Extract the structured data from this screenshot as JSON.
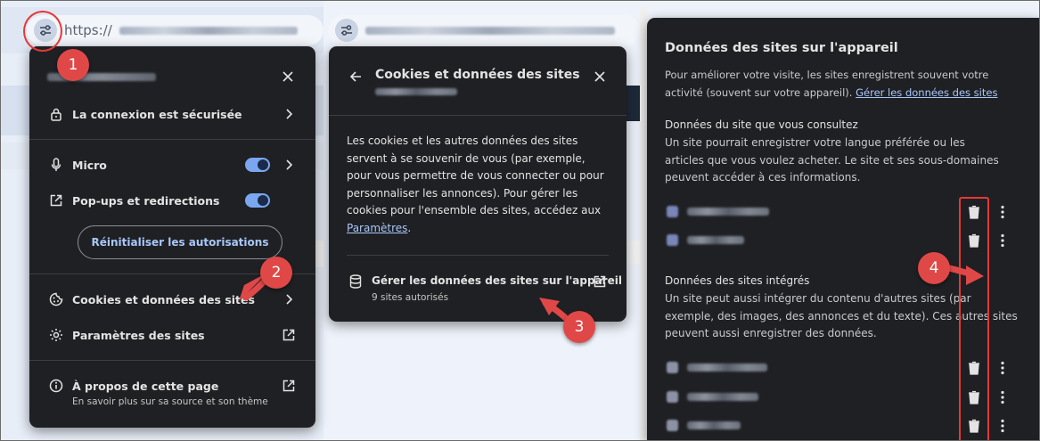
{
  "browser": {
    "url_prefix": "https://"
  },
  "site_panel": {
    "items": {
      "secure": "La connexion est sécurisée",
      "micro": "Micro",
      "popups": "Pop-ups et redirections",
      "reset": "Réinitialiser les autorisations",
      "cookies": "Cookies et données des sites",
      "settings": "Paramètres des sites",
      "about": "À propos de cette page",
      "about_sub": "En savoir plus sur sa source et son thème"
    },
    "toggles": {
      "micro": true,
      "popups": true
    }
  },
  "cookies_panel": {
    "title": "Cookies et données des sites",
    "body": "Les cookies et les autres données des sites servent à se souvenir de vous (par exemple, pour vous permettre de vous connecter ou pour personnaliser les annonces). Pour gérer les cookies pour l'ensemble des sites, accédez aux ",
    "body_link": "Paramètres",
    "body_end": ".",
    "manage": "Gérer les données des sites sur l'appareil",
    "manage_sub": "9 sites autorisés"
  },
  "device_panel": {
    "title": "Données des sites sur l'appareil",
    "intro": "Pour améliorer votre visite, les sites enregistrent souvent votre activité (souvent sur votre appareil). ",
    "intro_link": "Gérer les données des sites",
    "section1_title": "Données du site que vous consultez",
    "section1_body": "Un site pourrait enregistrer votre langue préférée ou les articles que vous voulez acheter. Le site et ses sous-domaines peuvent accéder à ces informations.",
    "section2_title": "Données des sites intégrés",
    "section2_body": "Un site peut aussi intégrer du contenu d'autres sites (par exemple, des images, des annonces et du texte). Ces autres sites peuvent aussi enregistrer des données."
  },
  "badges": [
    "1",
    "2",
    "3",
    "4"
  ],
  "colors": {
    "panel_bg": "#1f2023",
    "accent": "#a8c7fa",
    "toggle": "#7aa7ef",
    "badge": "#e04848",
    "highlight": "#e53935"
  },
  "icons": [
    "tune-icon",
    "lock-icon",
    "mic-icon",
    "external-link-icon",
    "cookie-icon",
    "gear-icon",
    "info-icon",
    "back-arrow-icon",
    "close-icon",
    "database-icon",
    "trash-icon",
    "more-vert-icon",
    "chevron-right-icon"
  ]
}
